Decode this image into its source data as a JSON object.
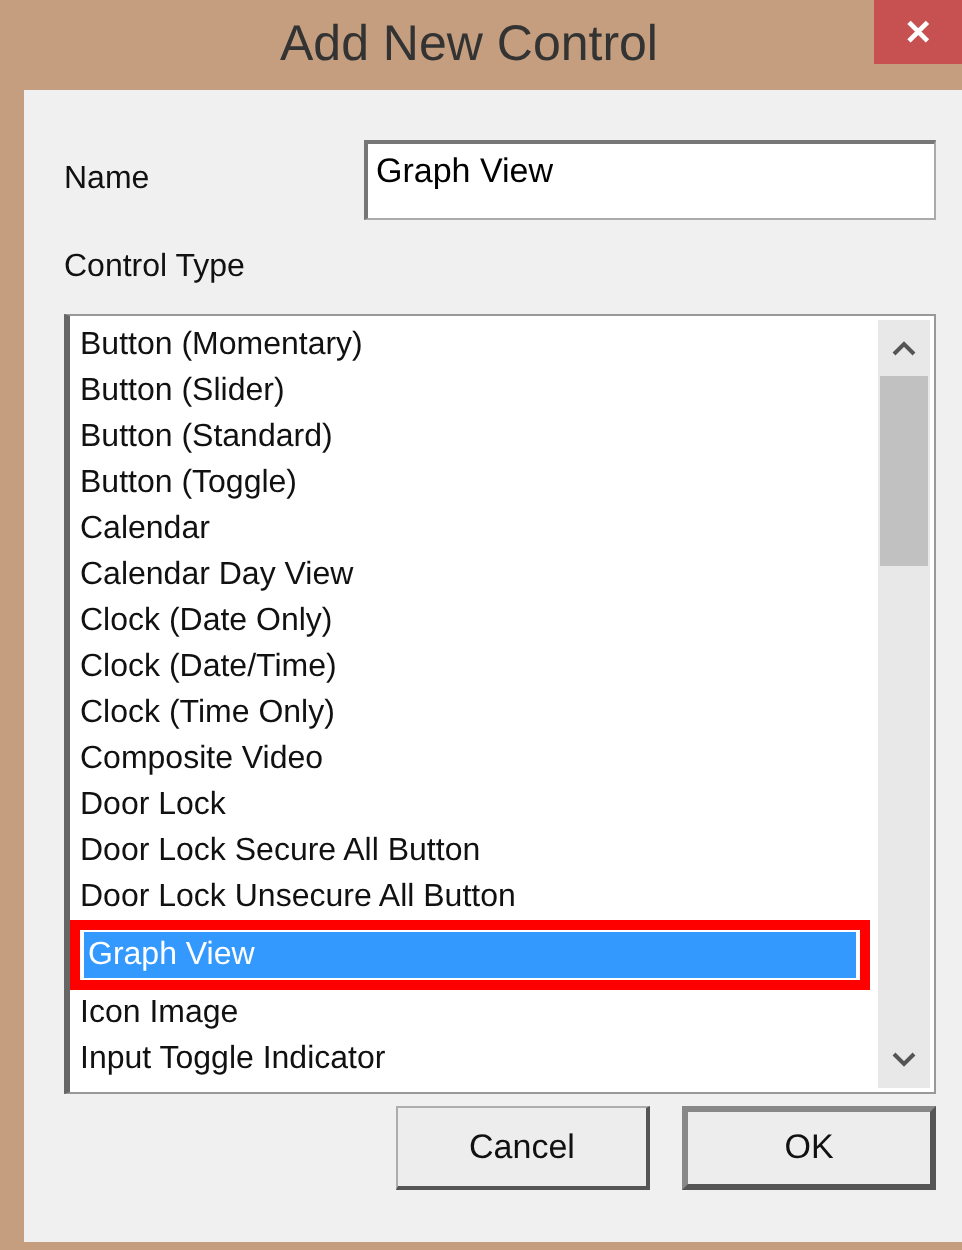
{
  "window": {
    "title": "Add New Control",
    "close": "✕"
  },
  "name_field": {
    "label": "Name",
    "value": "Graph View"
  },
  "control_type": {
    "label": "Control Type",
    "items": [
      {
        "label": "Button (Momentary)",
        "selected": false,
        "annotated": false
      },
      {
        "label": "Button (Slider)",
        "selected": false,
        "annotated": false
      },
      {
        "label": "Button (Standard)",
        "selected": false,
        "annotated": false
      },
      {
        "label": "Button (Toggle)",
        "selected": false,
        "annotated": false
      },
      {
        "label": "Calendar",
        "selected": false,
        "annotated": false
      },
      {
        "label": "Calendar Day View",
        "selected": false,
        "annotated": false
      },
      {
        "label": "Clock (Date Only)",
        "selected": false,
        "annotated": false
      },
      {
        "label": "Clock (Date/Time)",
        "selected": false,
        "annotated": false
      },
      {
        "label": "Clock (Time Only)",
        "selected": false,
        "annotated": false
      },
      {
        "label": "Composite Video",
        "selected": false,
        "annotated": false
      },
      {
        "label": "Door Lock",
        "selected": false,
        "annotated": false
      },
      {
        "label": "Door Lock Secure All Button",
        "selected": false,
        "annotated": false
      },
      {
        "label": "Door Lock Unsecure All Button",
        "selected": false,
        "annotated": false
      },
      {
        "label": "Graph View",
        "selected": true,
        "annotated": true
      },
      {
        "label": "Icon Image",
        "selected": false,
        "annotated": false
      },
      {
        "label": "Input Toggle Indicator",
        "selected": false,
        "annotated": false
      }
    ]
  },
  "buttons": [
    {
      "label": "Cancel",
      "default": false
    },
    {
      "label": "OK",
      "default": true
    }
  ]
}
